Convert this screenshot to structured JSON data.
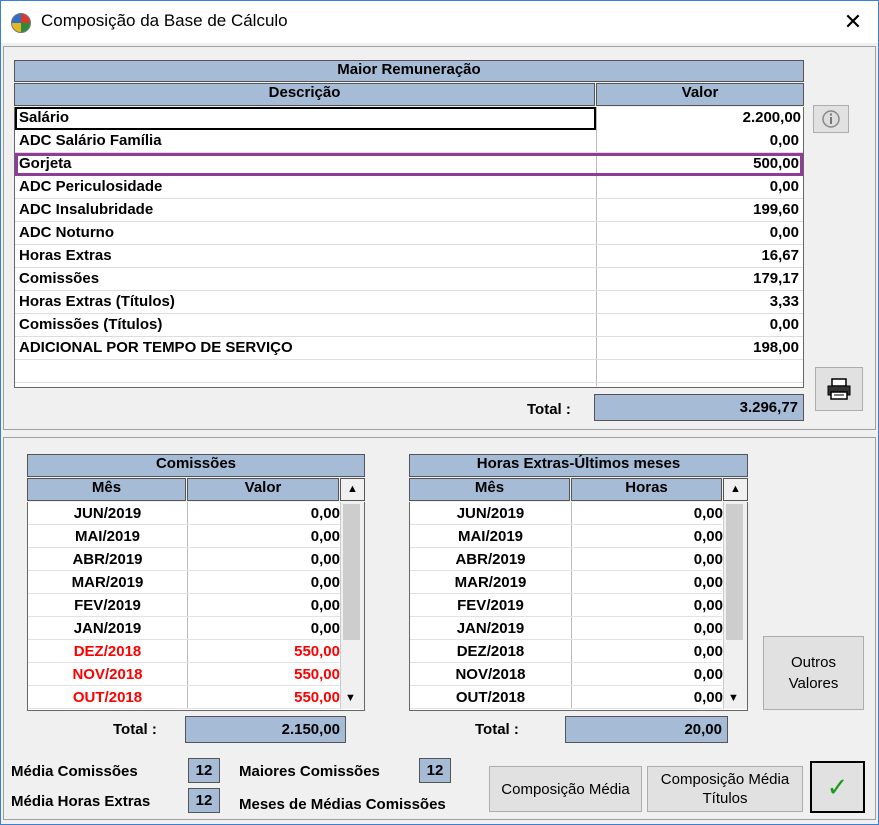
{
  "window": {
    "title": "Composição da Base de Cálculo",
    "close_glyph": "✕"
  },
  "maior_remuneracao": {
    "title": "Maior Remuneração",
    "col_desc": "Descrição",
    "col_valor": "Valor",
    "rows": [
      {
        "desc": "Salário",
        "valor": "2.200,00"
      },
      {
        "desc": "ADC Salário Família",
        "valor": "0,00"
      },
      {
        "desc": "Gorjeta",
        "valor": "500,00"
      },
      {
        "desc": "ADC Periculosidade",
        "valor": "0,00"
      },
      {
        "desc": "ADC Insalubridade",
        "valor": "199,60"
      },
      {
        "desc": "ADC Noturno",
        "valor": "0,00"
      },
      {
        "desc": "Horas Extras",
        "valor": "16,67"
      },
      {
        "desc": "Comissões",
        "valor": "179,17"
      },
      {
        "desc": "Horas Extras (Títulos)",
        "valor": "3,33"
      },
      {
        "desc": "Comissões (Títulos)",
        "valor": "0,00"
      },
      {
        "desc": "ADICIONAL POR TEMPO DE SERVIÇO",
        "valor": "198,00"
      }
    ],
    "total_label": "Total :",
    "total_value": "3.296,77"
  },
  "comissoes": {
    "title": "Comissões",
    "col_mes": "Mês",
    "col_valor": "Valor",
    "rows": [
      {
        "mes": "JUN/2019",
        "valor": "0,00",
        "red": false
      },
      {
        "mes": "MAI/2019",
        "valor": "0,00",
        "red": false
      },
      {
        "mes": "ABR/2019",
        "valor": "0,00",
        "red": false
      },
      {
        "mes": "MAR/2019",
        "valor": "0,00",
        "red": false
      },
      {
        "mes": "FEV/2019",
        "valor": "0,00",
        "red": false
      },
      {
        "mes": "JAN/2019",
        "valor": "0,00",
        "red": false
      },
      {
        "mes": "DEZ/2018",
        "valor": "550,00",
        "red": true
      },
      {
        "mes": "NOV/2018",
        "valor": "550,00",
        "red": true
      },
      {
        "mes": "OUT/2018",
        "valor": "550,00",
        "red": true
      }
    ],
    "total_label": "Total :",
    "total_value": "2.150,00"
  },
  "horas_extras": {
    "title": "Horas Extras-Últimos meses",
    "col_mes": "Mês",
    "col_horas": "Horas",
    "rows": [
      {
        "mes": "JUN/2019",
        "horas": "0,00"
      },
      {
        "mes": "MAI/2019",
        "horas": "0,00"
      },
      {
        "mes": "ABR/2019",
        "horas": "0,00"
      },
      {
        "mes": "MAR/2019",
        "horas": "0,00"
      },
      {
        "mes": "FEV/2019",
        "horas": "0,00"
      },
      {
        "mes": "JAN/2019",
        "horas": "0,00"
      },
      {
        "mes": "DEZ/2018",
        "horas": "0,00"
      },
      {
        "mes": "NOV/2018",
        "horas": "0,00"
      },
      {
        "mes": "OUT/2018",
        "horas": "0,00"
      }
    ],
    "total_label": "Total :",
    "total_value": "20,00"
  },
  "footer": {
    "media_comissoes_label": "Média Comissões",
    "media_comissoes_value": "12",
    "media_horas_label": "Média Horas Extras",
    "media_horas_value": "12",
    "maiores_comissoes_label": "Maiores Comissões",
    "maiores_comissoes_value": "12",
    "meses_medias_label": "Meses de Médias Comissões",
    "composicao_media_btn": "Composição Média",
    "composicao_titulos_btn_line1": "Composição Média",
    "composicao_titulos_btn_line2": "Títulos",
    "ok_glyph": "✓"
  },
  "outros_valores_line1": "Outros",
  "outros_valores_line2": "Valores",
  "icons": {
    "info": "info-icon",
    "print": "printer-icon",
    "ok": "checkmark-icon"
  },
  "colors": {
    "header_blue": "#a6bcd6",
    "highlight_purple": "#8e3c97",
    "red_text": "#ff0000",
    "ok_green": "#1a9a1a"
  }
}
